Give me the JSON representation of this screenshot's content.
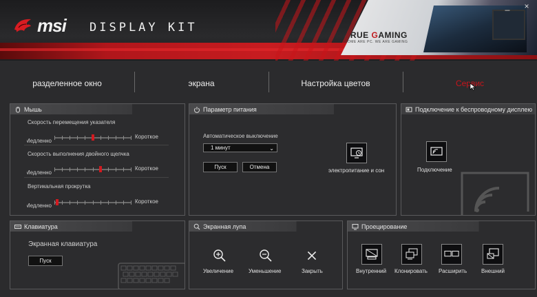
{
  "app": {
    "brand": "msi",
    "title": "DISPLAY KIT",
    "window_controls": [
      "_",
      "×"
    ]
  },
  "promo": {
    "headline_a": "TRUE ",
    "headline_b": "G",
    "headline_c": "AMING",
    "subline": "SOME ARE PC. WE ARE GAMING"
  },
  "tabs": [
    {
      "label": "разделенное окно"
    },
    {
      "label": "экрана"
    },
    {
      "label": "Настройка цветов"
    },
    {
      "label": "Сервис"
    }
  ],
  "mouse": {
    "title": "Мышь",
    "pointer_speed_label": "Скорость перемещения указателя",
    "double_click_label": "Скорость выполнения двойного щелчка",
    "scroll_label": "Вертикальная прокрутка",
    "slow_label": "Медленно",
    "fast_label": "Короткое",
    "pointer_speed_value": 0.5,
    "double_click_value": 0.6,
    "scroll_value": 0.02
  },
  "power": {
    "title": "Параметр питания",
    "auto_off_label": "Автоматическое выключение",
    "select_value": "1 минут",
    "start_label": "Пуск",
    "cancel_label": "Отмена",
    "sleep_label": "электропитание и сон"
  },
  "wireless": {
    "title": "Подключение к беспроводному дисплею",
    "connect_label": "Подключение"
  },
  "keyboard": {
    "title": "Клавиатура",
    "onscreen_label": "Экранная клавиатура",
    "start_label": "Пуск"
  },
  "magnifier": {
    "title": "Экранная лупа",
    "zoom_in_label": "Увеличение",
    "zoom_out_label": "Уменьшение",
    "close_label": "Закрыть"
  },
  "projection": {
    "title": "Проецирование",
    "internal_label": "Внутренний",
    "clone_label": "Клонировать",
    "extend_label": "Расширить",
    "external_label": "Внешний"
  },
  "colors": {
    "accent": "#c8141b"
  }
}
